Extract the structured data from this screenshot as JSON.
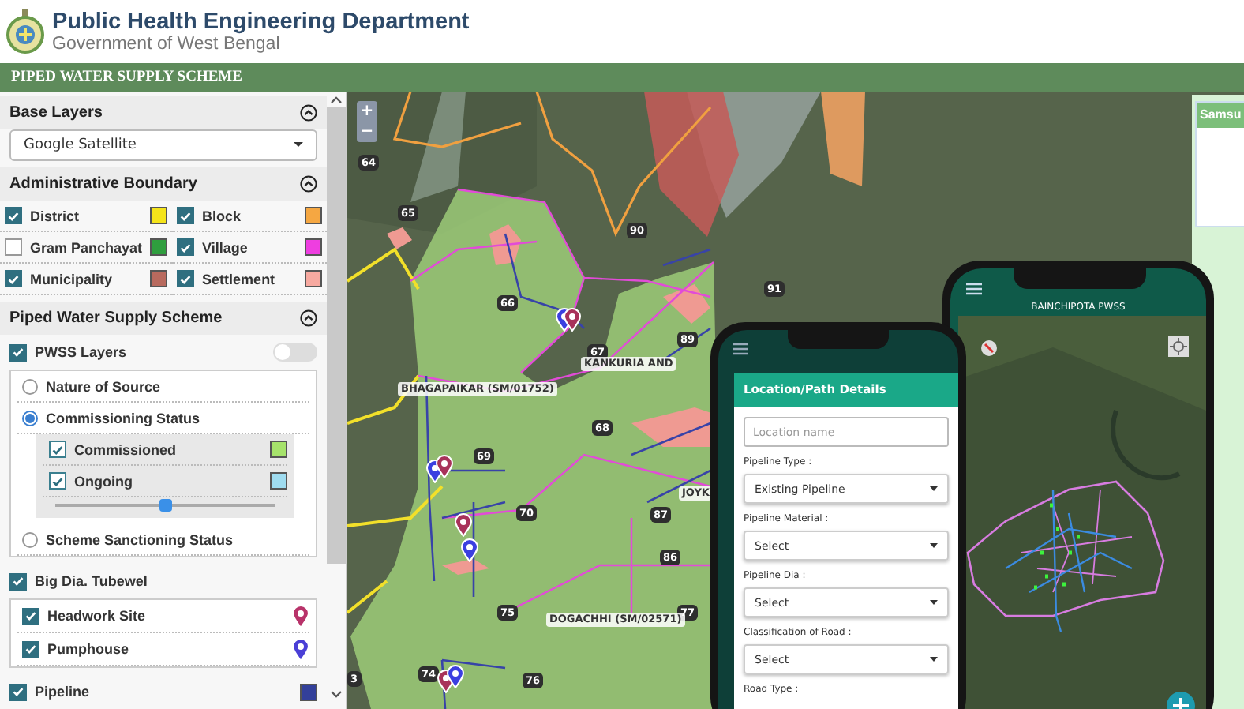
{
  "header": {
    "title": "Public Health Engineering Department",
    "subtitle": "Government of West Bengal"
  },
  "banner": "PIPED WATER SUPPLY SCHEME",
  "sidebar": {
    "base_layers": {
      "title": "Base Layers",
      "expanded": true,
      "select_value": "Google Satellite"
    },
    "admin_boundary": {
      "title": "Administrative Boundary",
      "expanded": true,
      "layers": [
        {
          "label": "District",
          "checked": true,
          "color": "#f5e41a"
        },
        {
          "label": "Block",
          "checked": true,
          "color": "#f5a742"
        },
        {
          "label": "Gram Panchayat",
          "checked": false,
          "color": "#2f9e3e"
        },
        {
          "label": "Village",
          "checked": true,
          "color": "#ee3ee0"
        },
        {
          "label": "Municipality",
          "checked": true,
          "color": "#b86a5e"
        },
        {
          "label": "Settlement",
          "checked": true,
          "color": "#f7a9a0"
        }
      ]
    },
    "pwss": {
      "title": "Piped Water Supply Scheme",
      "expanded": true,
      "layers_toggle": {
        "label": "PWSS Layers",
        "checked": true,
        "on": false
      },
      "options": [
        {
          "label": "Nature of Source",
          "selected": false
        },
        {
          "label": "Commissioning Status",
          "selected": true
        },
        {
          "label": "Scheme Sanctioning Status",
          "selected": false
        }
      ],
      "status_items": [
        {
          "label": "Commissioned",
          "checked": true,
          "color": "#a6e36b"
        },
        {
          "label": "Ongoing",
          "checked": true,
          "color": "#9fdcf0"
        }
      ],
      "opacity_slider": {
        "level": 0.5
      }
    },
    "tubewell": {
      "label": "Big Dia. Tubewel",
      "checked": true,
      "items": [
        {
          "label": "Headwork Site",
          "checked": true,
          "color": "#b8336a"
        },
        {
          "label": "Pumphouse",
          "checked": true,
          "color": "#4a3fd6"
        }
      ]
    },
    "pipeline": {
      "label": "Pipeline",
      "checked": true,
      "color": "#33409a"
    }
  },
  "map": {
    "zoom_buttons": [
      "+",
      "−"
    ],
    "village_labels": [
      "BHAGAPAIKAR (SM/01752)",
      "KANKURIA AND",
      "JOYK",
      "DOGACHHI (SM/02571)"
    ],
    "road_numbers": [
      "64",
      "65",
      "66",
      "67",
      "68",
      "69",
      "70",
      "75",
      "74",
      "76",
      "77",
      "86",
      "87",
      "89",
      "90",
      "91",
      "3"
    ]
  },
  "phone_form": {
    "title": "Location/Path Details",
    "name_field": {
      "placeholder": "Location name"
    },
    "fields": [
      {
        "label": "Pipeline Type :",
        "value": "Existing Pipeline"
      },
      {
        "label": "Pipeline Material :",
        "value": "Select"
      },
      {
        "label": "Pipeline Dia :",
        "value": "Select"
      },
      {
        "label": "Classification of Road :",
        "value": "Select"
      }
    ],
    "last_label": "Road Type :"
  },
  "phone_map": {
    "title": "BAINCHIPOTA PWSS"
  },
  "side_card": {
    "title": "Samsu"
  }
}
